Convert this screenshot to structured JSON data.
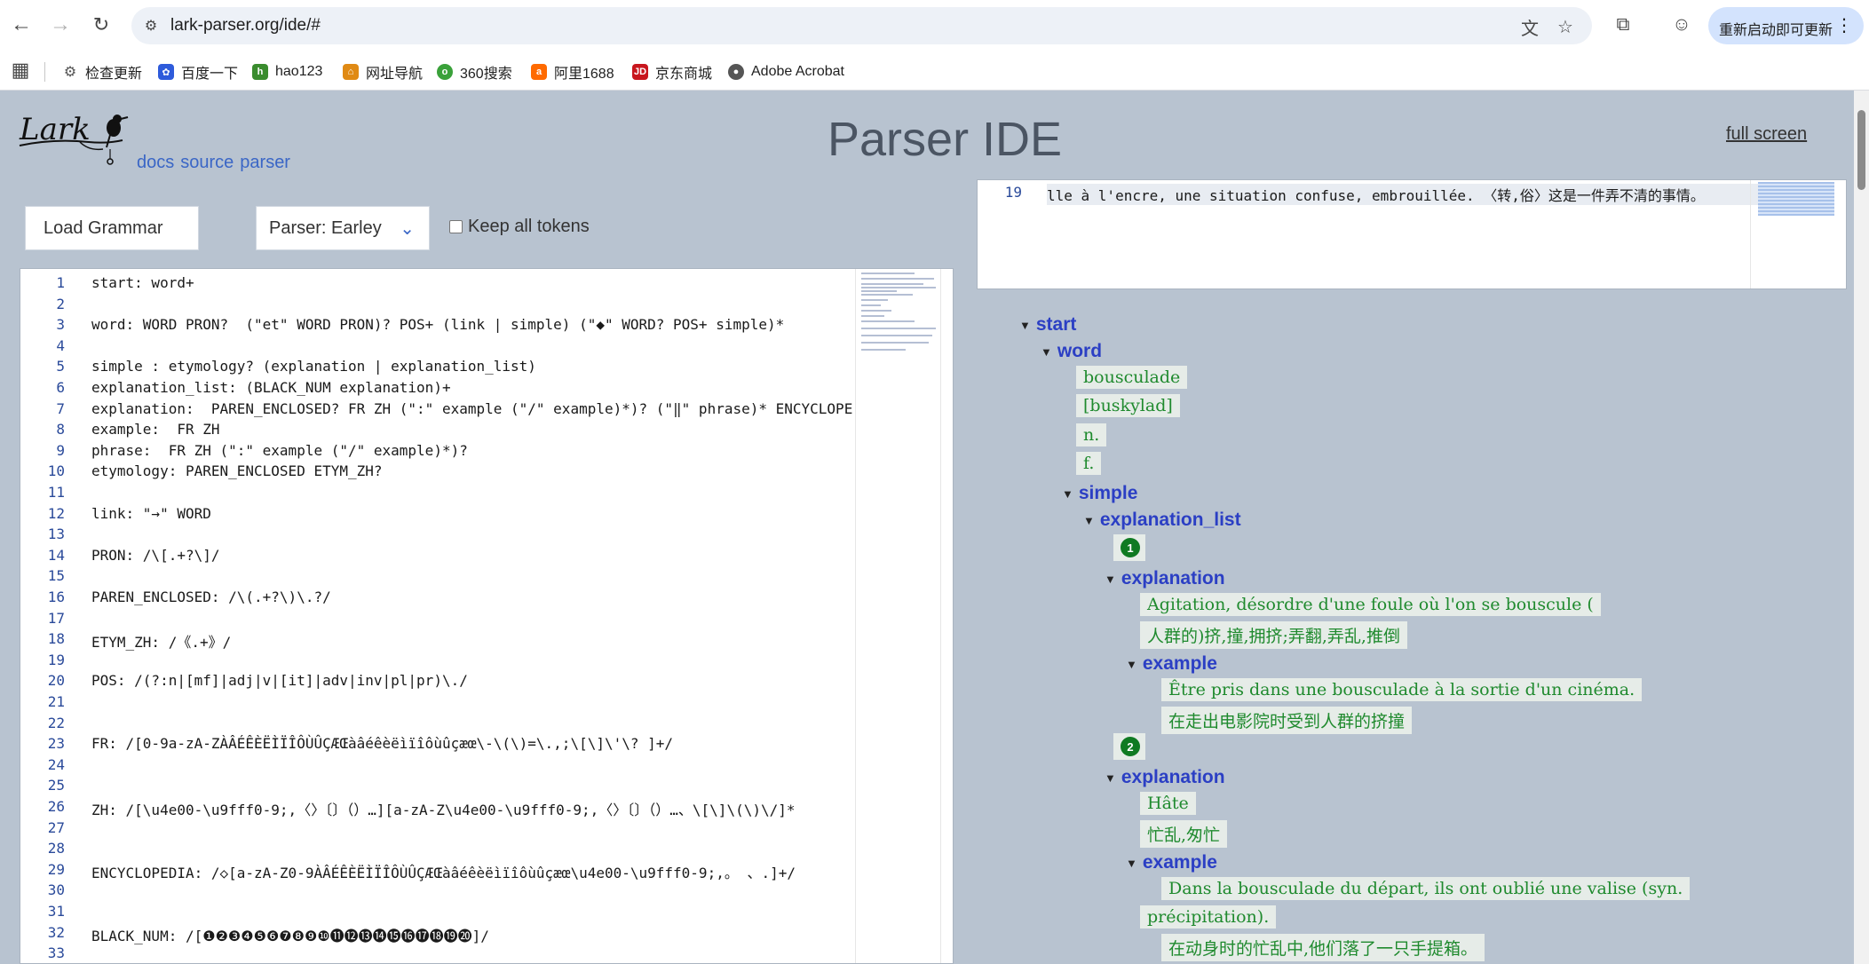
{
  "browser": {
    "url": "lark-parser.org/ide/#",
    "update_label": "重新启动即可更新"
  },
  "bookmarks": [
    {
      "label": "检查更新",
      "icon": "gear-icon"
    },
    {
      "label": "百度一下",
      "icon": "baidu-icon"
    },
    {
      "label": "hao123",
      "icon": "hao123-icon"
    },
    {
      "label": "网址导航",
      "icon": "nav-icon"
    },
    {
      "label": "360搜索",
      "icon": "360-icon"
    },
    {
      "label": "阿里1688",
      "icon": "ali1688-icon"
    },
    {
      "label": "京东商城",
      "icon": "jd-icon"
    },
    {
      "label": "Adobe Acrobat",
      "icon": "acrobat-icon"
    }
  ],
  "header": {
    "logo_text": "Lark",
    "links": [
      "docs",
      "source",
      "parser"
    ],
    "title": "Parser IDE",
    "fullscreen": "full screen"
  },
  "controls": {
    "load_grammar": "Load Grammar",
    "parser_select": "Parser: Earley",
    "keep_tokens": "Keep all tokens"
  },
  "grammar_lines": [
    {
      "n": "1",
      "text": "start: word+"
    },
    {
      "n": "2",
      "text": ""
    },
    {
      "n": "3",
      "text": "word: WORD PRON?  (\"et\" WORD PRON)? POS+ (link | simple) (\"◆\" WORD? POS+ simple)*"
    },
    {
      "n": "4",
      "text": ""
    },
    {
      "n": "5",
      "text": "simple : etymology? (explanation | explanation_list)"
    },
    {
      "n": "6",
      "text": "explanation_list: (BLACK_NUM explanation)+"
    },
    {
      "n": "7",
      "text": "explanation:  PAREN_ENCLOSED? FR ZH (\":\" example (\"/\" example)*)? (\"‖\" phrase)* ENCYCLOPE"
    },
    {
      "n": "8",
      "text": "example:  FR ZH"
    },
    {
      "n": "9",
      "text": "phrase:  FR ZH (\":\" example (\"/\" example)*)?"
    },
    {
      "n": "10",
      "text": "etymology: PAREN_ENCLOSED ETYM_ZH?"
    },
    {
      "n": "11",
      "text": ""
    },
    {
      "n": "12",
      "text": "link: \"→\" WORD"
    },
    {
      "n": "13",
      "text": ""
    },
    {
      "n": "14",
      "text": "PRON: /\\[.+?\\]/"
    },
    {
      "n": "15",
      "text": ""
    },
    {
      "n": "16",
      "text": "PAREN_ENCLOSED: /\\(.+?\\)\\.?/"
    },
    {
      "n": "17",
      "text": ""
    },
    {
      "n": "18",
      "text": "ETYM_ZH: /《.+》/"
    },
    {
      "n": "19",
      "text": ""
    },
    {
      "n": "20",
      "text": "POS: /(?:n|[mf]|adj|v|[it]|adv|inv|pl|pr)\\./"
    },
    {
      "n": "21",
      "text": ""
    },
    {
      "n": "22",
      "text": ""
    },
    {
      "n": "23",
      "text": "FR: /[0-9a-zA-ZÀÂÉÊÈËÌÏÎÔÙÛÇÆŒàâéêèëìïîôùûçæœ\\-\\(\\)=\\.,;\\[\\]\\'\\? ]+/"
    },
    {
      "n": "24",
      "text": ""
    },
    {
      "n": "25",
      "text": ""
    },
    {
      "n": "26",
      "text": "ZH: /[\\u4e00-\\u9fff0-9;,〈〉〔〕（）…][a-zA-Z\\u4e00-\\u9fff0-9;,〈〉〔〕（）…、\\[\\]\\(\\)\\/]*"
    },
    {
      "n": "27",
      "text": ""
    },
    {
      "n": "28",
      "text": ""
    },
    {
      "n": "29",
      "text": "ENCYCLOPEDIA: /◇[a-zA-Z0-9ÀÂÉÊÈËÌÏÎÔÙÛÇÆŒàâéêèëìïîôùûçæœ\\u4e00-\\u9fff0-9;,。 、.]+/"
    },
    {
      "n": "30",
      "text": ""
    },
    {
      "n": "31",
      "text": ""
    },
    {
      "n": "32",
      "text": "BLACK_NUM: /[❶❷❸❹❺❻❼❽❾❿⓫⓬⓭⓮⓯⓰⓱⓲⓳⓴]/"
    },
    {
      "n": "33",
      "text": ""
    }
  ],
  "input": {
    "line_number": "19",
    "text": "lle à l'encre, une situation confuse, embrouillée. 〈转,俗〉这是一件弄不清的事情。"
  },
  "tree": {
    "start": "start",
    "word": "word",
    "word_leaves": [
      "bousculade",
      "[buskylad]",
      "n.",
      "f."
    ],
    "simple": "simple",
    "explanation_list": "explanation_list",
    "num1": "1",
    "explanation1": "explanation",
    "exp1_fr": "Agitation, désordre d'une foule où l'on se bouscule (",
    "exp1_zh": "人群的)挤,撞,拥挤;弄翻,弄乱,推倒",
    "example1": "example",
    "ex1_fr": "Être pris dans une bousculade à la sortie d'un cinéma.",
    "ex1_zh": "在走出电影院时受到人群的挤撞",
    "num2": "2",
    "explanation2": "explanation",
    "exp2_fr": "Hâte",
    "exp2_zh": "忙乱,匆忙",
    "example2": "example",
    "ex2_fr1": "Dans la bousculade du départ, ils ont oublié une valise (syn.",
    "ex2_fr2": "précipitation).",
    "ex2_zh": "在动身时的忙乱中,他们落了一只手提箱。"
  }
}
